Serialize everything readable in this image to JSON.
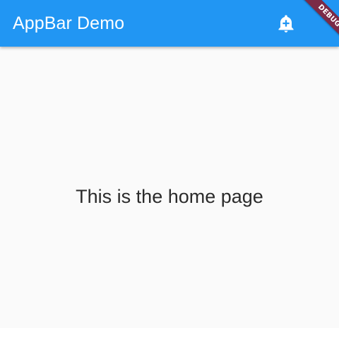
{
  "appbar": {
    "title": "AppBar Demo",
    "background_color": "#2196f3",
    "title_color": "#ffffff",
    "actions": [
      {
        "icon": "add-alert-icon",
        "color": "#ffffff"
      }
    ]
  },
  "body": {
    "background_color": "#fafafa",
    "text": "This is the home page",
    "text_color": "#2b2b2b"
  },
  "debug_banner": {
    "label": "DEBUG",
    "color": "#7b2b47"
  }
}
